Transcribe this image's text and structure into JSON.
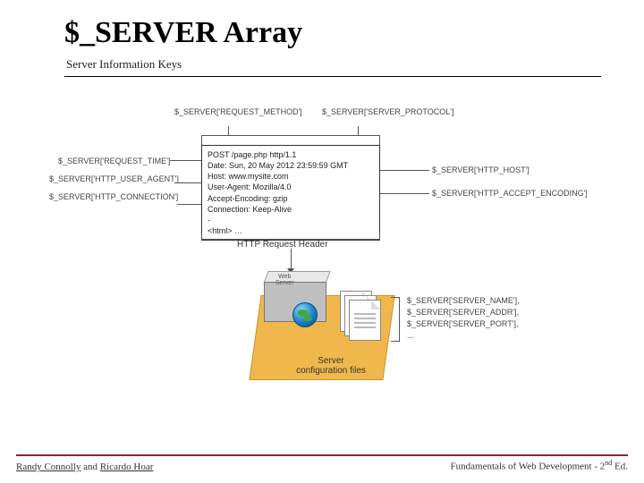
{
  "title": "$_SERVER Array",
  "subtitle": "Server Information Keys",
  "top": {
    "request_method": "$_SERVER['REQUEST_METHOD']",
    "server_protocol": "$_SERVER['SERVER_PROTOCOL']"
  },
  "left": {
    "request_time": "$_SERVER['REQUEST_TIME']",
    "http_user_agent": "$_SERVER['HTTP_USER_AGENT']",
    "http_connection": "$_SERVER['HTTP_CONNECTION']"
  },
  "right": {
    "http_host": "$_SERVER['HTTP_HOST']",
    "http_accept_encoding": "$_SERVER['HTTP_ACCEPT_ENCODING']"
  },
  "request": {
    "l1": "POST /page.php http/1.1",
    "l2": "Date: Sun, 20 May 2012 23:59:59 GMT",
    "l3": "Host: www.mysite.com",
    "l4": "User-Agent: Mozilla/4.0",
    "l5": "Accept-Encoding: gzip",
    "l6": "Connection: Keep-Alive",
    "l7": "-",
    "l8": "<html> …",
    "caption": "HTTP Request Header"
  },
  "webserver_label": "Web\nServer",
  "server_caption": "Server\nconfiguration files",
  "bottom": {
    "server_name": "$_SERVER['SERVER_NAME'],",
    "server_addr": "$_SERVER['SERVER_ADDR'],",
    "server_port": "$_SERVER['SERVER_PORT'],",
    "ellipsis": "..."
  },
  "footer": {
    "author1": "Randy Connolly",
    "and": " and ",
    "author2": "Ricardo Hoar",
    "book_prefix": "Fundamentals of Web Development - 2",
    "book_sup": "nd",
    "book_suffix": " Ed."
  }
}
